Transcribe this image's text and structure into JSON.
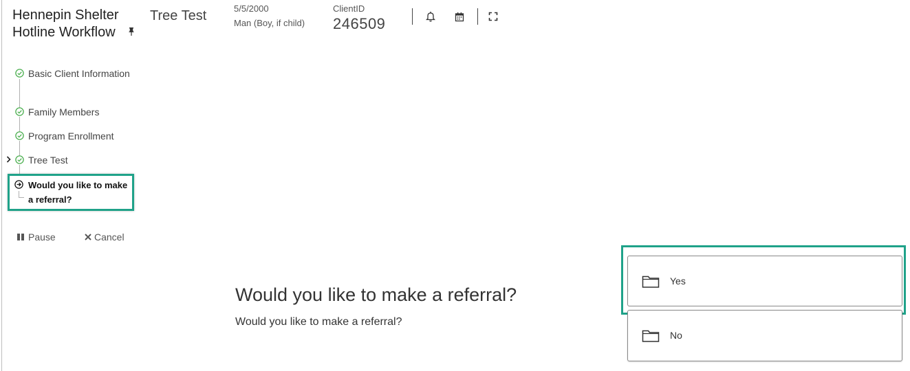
{
  "workflow": {
    "title": "Hennepin Shelter Hotline Workflow",
    "steps": [
      {
        "label": "Basic Client Information",
        "status": "complete"
      },
      {
        "label": "Family Members",
        "status": "complete"
      },
      {
        "label": "Program Enrollment",
        "status": "complete"
      },
      {
        "label": "Tree Test",
        "status": "complete"
      }
    ],
    "current_step": {
      "label": "Would you like to make a referral?"
    },
    "actions": {
      "pause_label": "Pause",
      "cancel_label": "Cancel"
    }
  },
  "header": {
    "task_title": "Tree Test",
    "dob": "5/5/2000",
    "gender": "Man (Boy, if child)",
    "client_id_label": "ClientID",
    "client_id": "246509",
    "icons": [
      "bell-icon",
      "calendar-icon",
      "fullscreen-icon"
    ]
  },
  "question": {
    "title": "Would you like to make a referral?",
    "subtitle": "Would you like to make a referral?",
    "options": [
      {
        "label": "Yes",
        "icon": "folder-icon"
      },
      {
        "label": "No",
        "icon": "folder-icon"
      }
    ]
  },
  "colors": {
    "accent_highlight": "#1fa289",
    "complete_check": "#4caf50"
  }
}
